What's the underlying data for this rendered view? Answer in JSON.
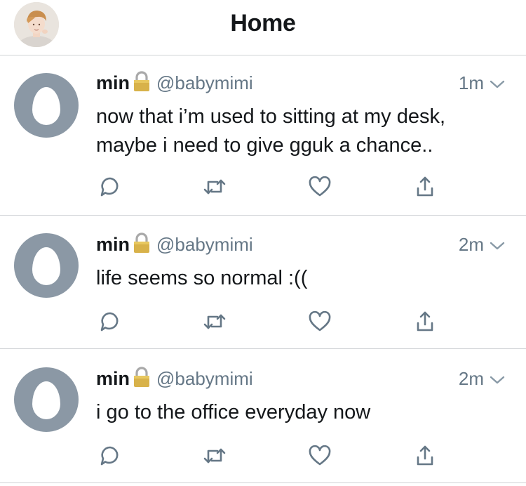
{
  "header": {
    "title": "Home",
    "avatar_icon": "profile-photo"
  },
  "tweets": [
    {
      "name": "min",
      "handle": "@babymimi",
      "time": "1m",
      "text_lines": [
        "now that i’m used to sitting at my desk,",
        "maybe i need to give gguk a chance.."
      ],
      "locked": true
    },
    {
      "name": "min",
      "handle": "@babymimi",
      "time": "2m",
      "text_lines": [
        "life seems so normal :(("
      ],
      "locked": true
    },
    {
      "name": "min",
      "handle": "@babymimi",
      "time": "2m",
      "text_lines": [
        "i go to the office everyday now"
      ],
      "locked": true
    }
  ],
  "icons": {
    "reply": "reply-icon",
    "retweet": "retweet-icon",
    "like": "heart-icon",
    "share": "share-icon",
    "lock": "lock-icon",
    "menu": "chevron-down-icon",
    "avatar": "default-egg-avatar"
  },
  "colors": {
    "avatar_bg": "#8b98a5",
    "secondary_text": "#657786",
    "icon": "#657786",
    "divider": "#d0d3d6"
  }
}
